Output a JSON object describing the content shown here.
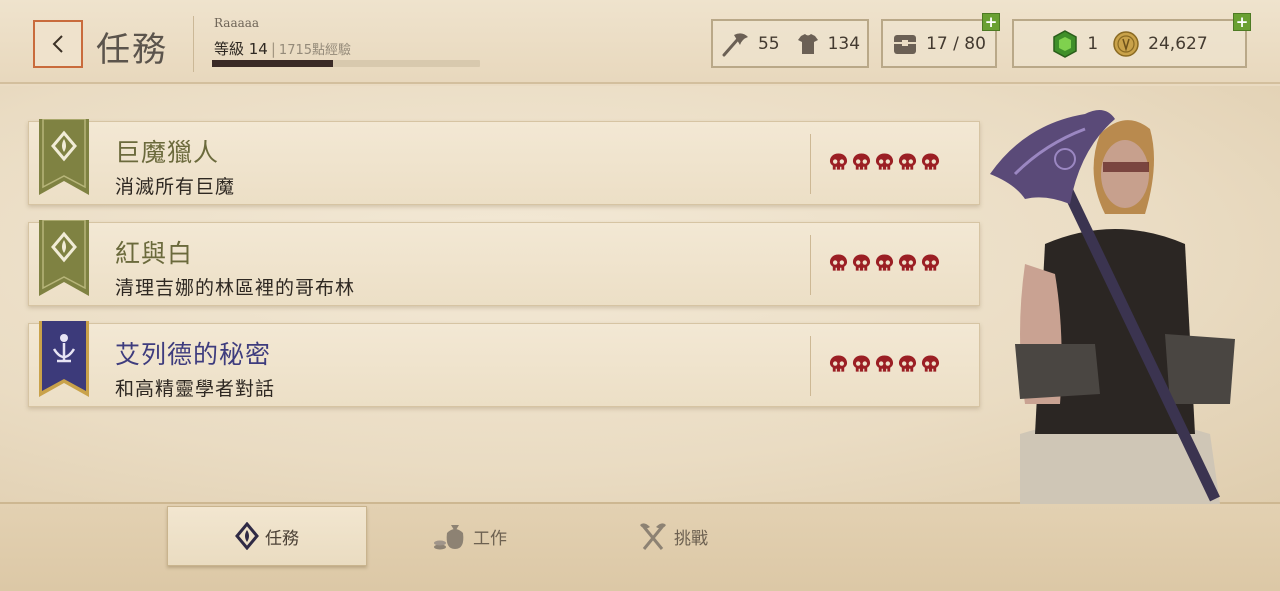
{
  "header": {
    "back_icon": "chevron-left-icon",
    "title": "任務",
    "player_name": "Raaaaa",
    "level_label": "等級 14",
    "separator": "|",
    "xp_label": "1715點經驗",
    "xp_progress": 0.45
  },
  "resources": {
    "axe_count": "55",
    "armor_count": "134",
    "storage": "17 / 80",
    "gems": "1",
    "gold": "24,627",
    "plus": "+"
  },
  "quests": [
    {
      "title": "巨魔獵人",
      "description": "消滅所有巨魔",
      "banner": "green",
      "difficulty": 5
    },
    {
      "title": "紅與白",
      "description": "清理吉娜的林區裡的哥布林",
      "banner": "green",
      "difficulty": 5
    },
    {
      "title": "艾列德的秘密",
      "description": "和高精靈學者對話",
      "banner": "blue",
      "difficulty": 5
    }
  ],
  "tabs": [
    {
      "label": "任務",
      "icon": "quest-diamond-icon",
      "active": true
    },
    {
      "label": "工作",
      "icon": "coin-bag-icon",
      "active": false
    },
    {
      "label": "挑戰",
      "icon": "crossed-axes-icon",
      "active": false
    }
  ],
  "colors": {
    "skull": "#9b1f24",
    "green_banner": "#7f8242",
    "blue_banner": "#3c3a7a",
    "accent_border": "#c96b3c",
    "plus_green": "#6aa032"
  }
}
